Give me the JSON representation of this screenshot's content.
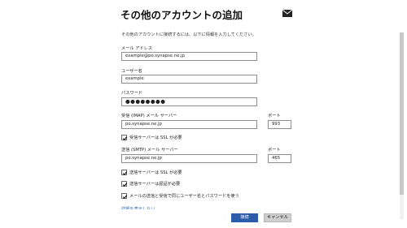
{
  "header": {
    "title": "その他のアカウントの追加",
    "icon": "mail-icon"
  },
  "intro": "その他のアカウントに接続するには、以下に情報を入力してください。",
  "email": {
    "label": "メール アドレス",
    "value": "example@po.synapse.ne.jp"
  },
  "username": {
    "label": "ユーザー名",
    "value": "example"
  },
  "password": {
    "label": "パスワード",
    "value": "●●●●●●●●"
  },
  "incoming": {
    "label": "受信 (IMAP) メール サーバー",
    "value": "po.synapse.ne.jp",
    "port_label": "ポート",
    "port": "993"
  },
  "checkbox_incoming_ssl": {
    "label": "受信サーバーは SSL が必要",
    "checked": true
  },
  "outgoing": {
    "label": "送信 (SMTP) メール サーバー",
    "value": "po.synapse.ne.jp",
    "port_label": "ポート",
    "port": "465"
  },
  "checkbox_outgoing_ssl": {
    "label": "送信サーバーは SSL が必要",
    "checked": true
  },
  "checkbox_outgoing_auth": {
    "label": "送信サーバーは認証が必要",
    "checked": true
  },
  "checkbox_same_credentials": {
    "label": "メールの送信と受信で同じユーザー名とパスワードを使う",
    "checked": true
  },
  "link": "詳細を表示しない",
  "buttons": {
    "connect": "接続",
    "cancel": "キャンセル"
  },
  "colors": {
    "accent": "#2d5ca8",
    "cancel_bg": "#cfcfcf",
    "link": "#3b6fbf"
  }
}
